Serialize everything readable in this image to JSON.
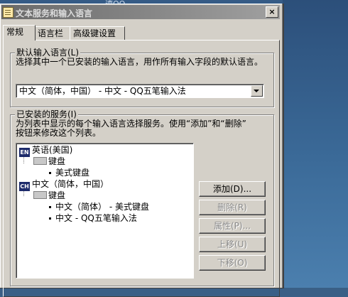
{
  "background": {
    "label": "速QQ"
  },
  "window": {
    "title": "文本服务和输入语言",
    "close_label": "×"
  },
  "tabs": [
    {
      "label": "常规"
    },
    {
      "label": "语言栏"
    },
    {
      "label": "高级键设置"
    }
  ],
  "default_language": {
    "group_title": "默认输入语言(L)",
    "description": "选择其中一个已安装的输入语言，用作所有输入字段的默认语言。",
    "selected": "中文（简体，中国） - 中文 - QQ五笔输入法"
  },
  "installed_services": {
    "group_title": "已安装的服务(I)",
    "description_line1": "为列表中显示的每个输入语言选择服务。使用“添加”和“删除”",
    "description_line2": "按钮来修改这个列表。",
    "tree": [
      {
        "badge": "EN",
        "label": "英语(美国)"
      },
      {
        "label": "键盘"
      },
      {
        "label": "美式键盘"
      },
      {
        "badge": "CH",
        "label": "中文（简体，中国）"
      },
      {
        "label": "键盘"
      },
      {
        "label": "中文（简体） - 美式键盘"
      },
      {
        "label": "中文 - QQ五笔输入法"
      }
    ]
  },
  "buttons": {
    "add": "添加(D)...",
    "remove": "删除(R)",
    "properties": "属性(P)...",
    "move_up": "上移(U)",
    "move_down": "下移(O)"
  }
}
